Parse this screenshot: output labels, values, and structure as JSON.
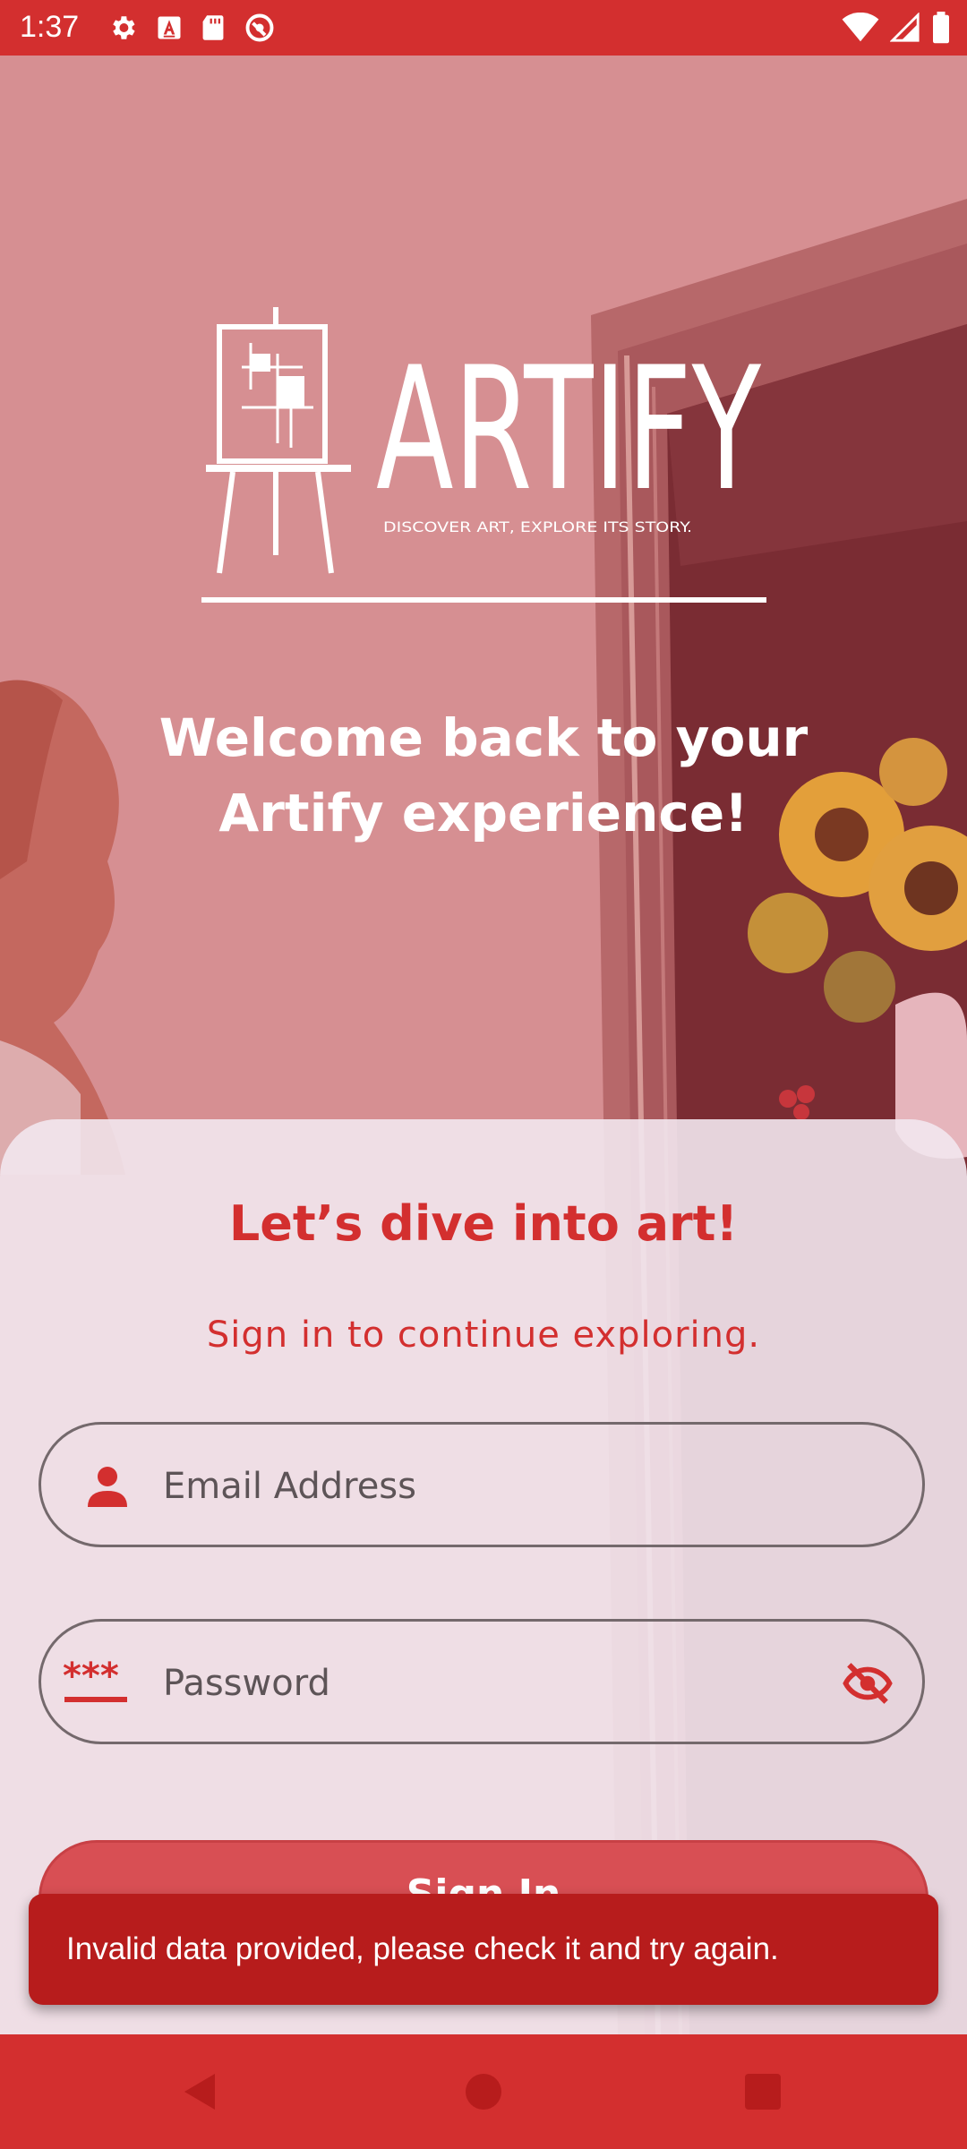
{
  "status_bar": {
    "time": "1:37",
    "left_icons": [
      "gear-icon",
      "a-badge-icon",
      "sd-card-icon",
      "do-not-disturb-icon"
    ],
    "right_icons": [
      "wifi-icon",
      "signal-icon",
      "battery-icon"
    ]
  },
  "logo": {
    "wordmark": "ARTIFY",
    "tagline": "DISCOVER ART, EXPLORE ITS STORY."
  },
  "welcome_text": "Welcome back to your Artify experience!",
  "sheet": {
    "title": "Let’s dive into art!",
    "subtitle": "Sign in to continue exploring."
  },
  "email_field": {
    "placeholder": "Email Address",
    "value": "",
    "icon": "person-icon"
  },
  "password_field": {
    "placeholder": "Password",
    "value": "",
    "icon": "password-icon",
    "toggle_icon": "eye-off-icon"
  },
  "signin_button": {
    "label": "Sign In"
  },
  "snackbar": {
    "message": "Invalid data provided, please check it and try again."
  },
  "nav_bar": {
    "buttons": [
      "back-icon",
      "home-icon",
      "recents-icon"
    ]
  },
  "colors": {
    "primary": "#d32f2f",
    "snackbar": "#b71c1c",
    "sheet": "#f2e7ee"
  }
}
